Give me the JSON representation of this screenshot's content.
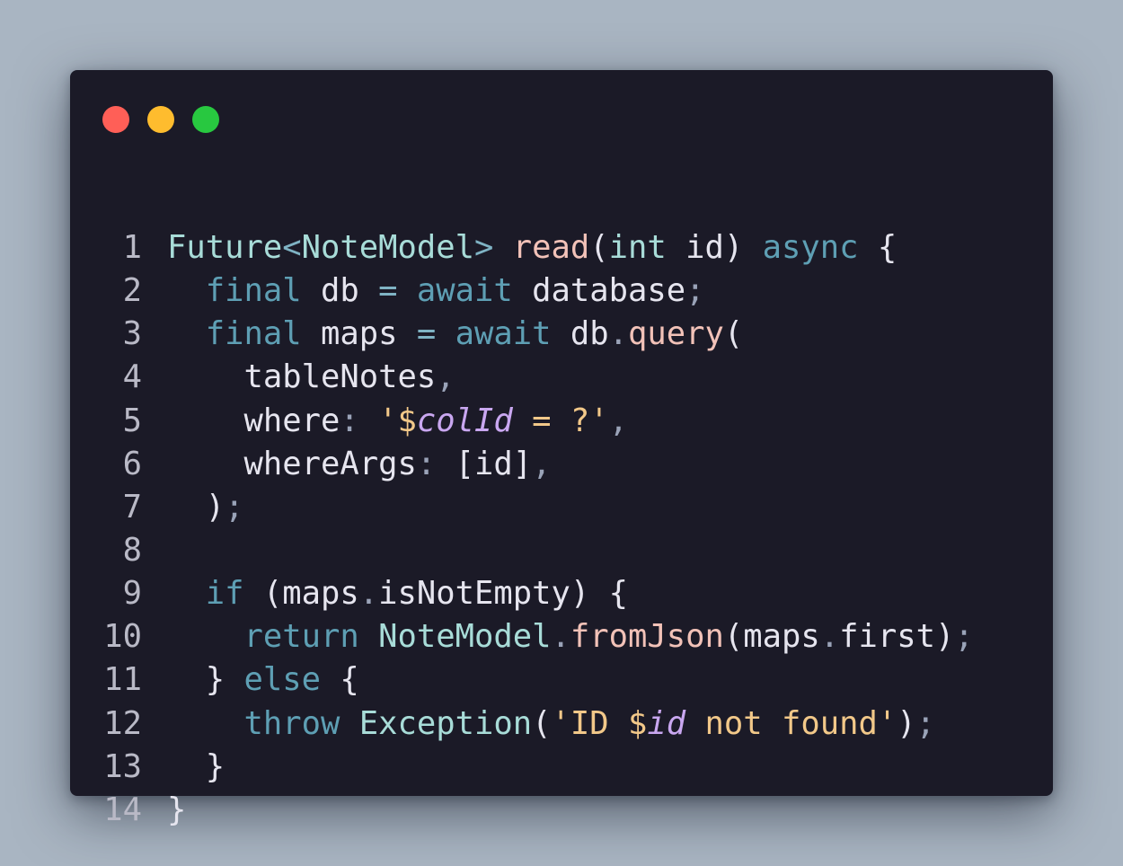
{
  "window": {
    "buttons": {
      "close": "red-dot",
      "minimize": "yellow-dot",
      "maximize": "green-dot"
    }
  },
  "code": {
    "language": "dart",
    "lines": [
      {
        "number": "1",
        "tokens": [
          {
            "t": "Future",
            "c": "ty"
          },
          {
            "t": "<",
            "c": "op"
          },
          {
            "t": "NoteModel",
            "c": "ty"
          },
          {
            "t": ">",
            "c": "op"
          },
          {
            "t": " "
          },
          {
            "t": "read",
            "c": "fn"
          },
          {
            "t": "("
          },
          {
            "t": "int",
            "c": "ty"
          },
          {
            "t": " id) "
          },
          {
            "t": "async",
            "c": "kw"
          },
          {
            "t": " {"
          }
        ]
      },
      {
        "number": "2",
        "tokens": [
          {
            "t": "  "
          },
          {
            "t": "final",
            "c": "kw"
          },
          {
            "t": " db "
          },
          {
            "t": "=",
            "c": "op"
          },
          {
            "t": " "
          },
          {
            "t": "await",
            "c": "kw"
          },
          {
            "t": " database"
          },
          {
            "t": ";",
            "c": "pn"
          }
        ]
      },
      {
        "number": "3",
        "tokens": [
          {
            "t": "  "
          },
          {
            "t": "final",
            "c": "kw"
          },
          {
            "t": " maps "
          },
          {
            "t": "=",
            "c": "op"
          },
          {
            "t": " "
          },
          {
            "t": "await",
            "c": "kw"
          },
          {
            "t": " db"
          },
          {
            "t": ".",
            "c": "pn"
          },
          {
            "t": "query",
            "c": "fn"
          },
          {
            "t": "("
          }
        ]
      },
      {
        "number": "4",
        "tokens": [
          {
            "t": "    tableNotes"
          },
          {
            "t": ",",
            "c": "pn"
          }
        ]
      },
      {
        "number": "5",
        "tokens": [
          {
            "t": "    where"
          },
          {
            "t": ":",
            "c": "pn"
          },
          {
            "t": " "
          },
          {
            "t": "'$",
            "c": "st"
          },
          {
            "t": "colId",
            "c": "it"
          },
          {
            "t": " = ?'",
            "c": "st"
          },
          {
            "t": ",",
            "c": "pn"
          }
        ]
      },
      {
        "number": "6",
        "tokens": [
          {
            "t": "    whereArgs"
          },
          {
            "t": ":",
            "c": "pn"
          },
          {
            "t": " [id]"
          },
          {
            "t": ",",
            "c": "pn"
          }
        ]
      },
      {
        "number": "7",
        "tokens": [
          {
            "t": "  )"
          },
          {
            "t": ";",
            "c": "pn"
          }
        ]
      },
      {
        "number": "8",
        "tokens": []
      },
      {
        "number": "9",
        "tokens": [
          {
            "t": "  "
          },
          {
            "t": "if",
            "c": "kw"
          },
          {
            "t": " (maps"
          },
          {
            "t": ".",
            "c": "pn"
          },
          {
            "t": "isNotEmpty) {"
          }
        ]
      },
      {
        "number": "10",
        "tokens": [
          {
            "t": "    "
          },
          {
            "t": "return",
            "c": "kw"
          },
          {
            "t": " "
          },
          {
            "t": "NoteModel",
            "c": "ty"
          },
          {
            "t": ".",
            "c": "pn"
          },
          {
            "t": "fromJson",
            "c": "fn"
          },
          {
            "t": "(maps"
          },
          {
            "t": ".",
            "c": "pn"
          },
          {
            "t": "first)"
          },
          {
            "t": ";",
            "c": "pn"
          }
        ]
      },
      {
        "number": "11",
        "tokens": [
          {
            "t": "  } "
          },
          {
            "t": "else",
            "c": "kw"
          },
          {
            "t": " {"
          }
        ]
      },
      {
        "number": "12",
        "tokens": [
          {
            "t": "    "
          },
          {
            "t": "throw",
            "c": "kw"
          },
          {
            "t": " "
          },
          {
            "t": "Exception",
            "c": "ty"
          },
          {
            "t": "("
          },
          {
            "t": "'ID $",
            "c": "st"
          },
          {
            "t": "id",
            "c": "it"
          },
          {
            "t": " not found'",
            "c": "st"
          },
          {
            "t": ")"
          },
          {
            "t": ";",
            "c": "pn"
          }
        ]
      },
      {
        "number": "13",
        "tokens": [
          {
            "t": "  }"
          }
        ]
      },
      {
        "number": "14",
        "tokens": [
          {
            "t": "}"
          }
        ]
      }
    ]
  }
}
